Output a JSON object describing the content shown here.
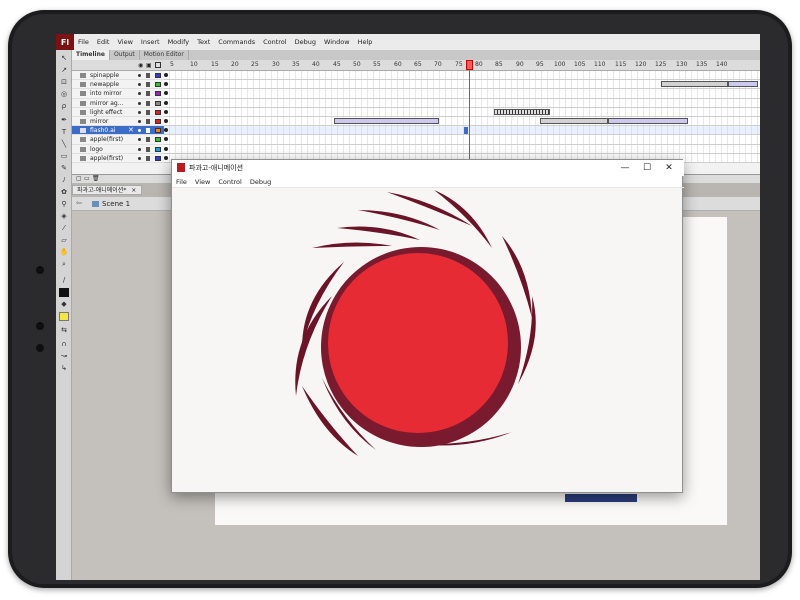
{
  "app": {
    "logo": "Fl",
    "menu": [
      "File",
      "Edit",
      "View",
      "Insert",
      "Modify",
      "Text",
      "Commands",
      "Control",
      "Debug",
      "Window",
      "Help"
    ]
  },
  "panel_tabs": [
    "Timeline",
    "Output",
    "Motion Editor"
  ],
  "timeline": {
    "frame_numbers": [
      "5",
      "10",
      "15",
      "20",
      "25",
      "30",
      "35",
      "40",
      "45",
      "50",
      "55",
      "60",
      "65",
      "70",
      "75",
      "80",
      "85",
      "90",
      "95",
      "100",
      "105",
      "110",
      "115",
      "120",
      "125",
      "130",
      "135",
      "140"
    ],
    "layers": [
      {
        "name": "spinapple",
        "color": "#2c3fd0"
      },
      {
        "name": "newapple",
        "color": "#2ec42e"
      },
      {
        "name": "into mirror",
        "color": "#a020c0"
      },
      {
        "name": "mirror ag...",
        "color": "#888888"
      },
      {
        "name": "light effect",
        "color": "#e02020"
      },
      {
        "name": "mirror",
        "color": "#e02020"
      },
      {
        "name": "flash0.ai",
        "color": "#ff7f00",
        "selected": true
      },
      {
        "name": "apple(first)",
        "color": "#2ec42e"
      },
      {
        "name": "logo",
        "color": "#1a9fe0"
      },
      {
        "name": "apple(first)",
        "color": "#2c3fd0"
      }
    ],
    "current_frame": 74
  },
  "document": {
    "tab_label": "파과고-애니메이션*",
    "scene_label": "Scene 1"
  },
  "player": {
    "title": "파과고-애니메이션",
    "menu": [
      "File",
      "View",
      "Control",
      "Debug"
    ],
    "min_symbol": "—",
    "max_symbol": "☐",
    "close_symbol": "✕"
  },
  "colors": {
    "sun_red": "#e62b35",
    "sun_ring": "#7a1a2e",
    "swoosh": "#6b1428",
    "playhead": "#e33333",
    "tablet_frame": "#1c1c1e"
  }
}
